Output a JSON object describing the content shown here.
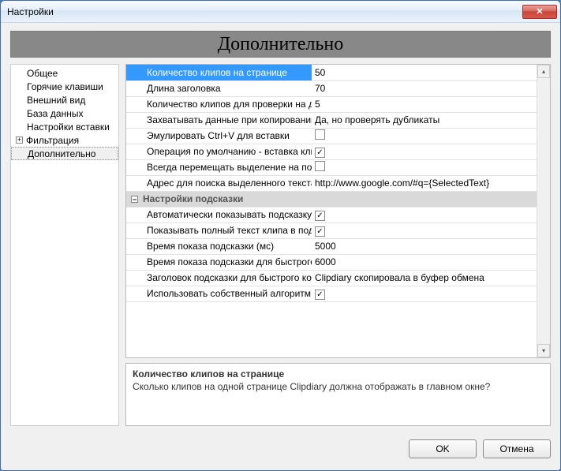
{
  "window": {
    "title": "Настройки",
    "close_label": "✕"
  },
  "header": "Дополнительно",
  "nav": {
    "items": [
      {
        "label": "Общее",
        "expander": "dots"
      },
      {
        "label": "Горячие клавиши",
        "expander": "dots"
      },
      {
        "label": "Внешний вид",
        "expander": "dots"
      },
      {
        "label": "База данных",
        "expander": "dots"
      },
      {
        "label": "Настройки вставки",
        "expander": "dots"
      },
      {
        "label": "Фильтрация",
        "expander": "plus"
      },
      {
        "label": "Дополнительно",
        "expander": "dots",
        "selected": true
      }
    ]
  },
  "grid": {
    "rows": [
      {
        "type": "row",
        "label": "Количество клипов на странице",
        "value": "50",
        "selected": true
      },
      {
        "type": "row",
        "label": "Длина заголовка",
        "value": "70"
      },
      {
        "type": "row",
        "label": "Количество клипов для проверки на дуб",
        "value": "5"
      },
      {
        "type": "row",
        "label": "Захватывать данные при копировании к",
        "value": "Да, но проверять дубликаты"
      },
      {
        "type": "row",
        "label": "Эмулировать Ctrl+V для вставки",
        "value_type": "check",
        "checked": false
      },
      {
        "type": "row",
        "label": "Операция по умолчанию - вставка клип",
        "value_type": "check",
        "checked": true
      },
      {
        "type": "row",
        "label": "Всегда перемещать выделение на посл",
        "value_type": "check",
        "checked": false
      },
      {
        "type": "row",
        "label": "Адрес для поиска выделенного текста в",
        "value": "http://www.google.com/#q={SelectedText}"
      },
      {
        "type": "section",
        "label": "Настройки подсказки"
      },
      {
        "type": "row",
        "label": "Автоматически показывать подсказку п",
        "value_type": "check",
        "checked": true
      },
      {
        "type": "row",
        "label": "Показывать полный текст клипа в подск",
        "value_type": "check",
        "checked": true
      },
      {
        "type": "row",
        "label": "Время показа подсказки (мс)",
        "value": "5000"
      },
      {
        "type": "row",
        "label": "Время показа подсказки для быстрого к",
        "value": "6000"
      },
      {
        "type": "row",
        "label": "Заголовок подсказки для быстрого копи",
        "value": "   Clipdiary скопировала в буфер обмена"
      },
      {
        "type": "row",
        "label": "Использовать собственный алгоритм д",
        "value_type": "check",
        "checked": true
      }
    ]
  },
  "help": {
    "title": "Количество клипов на странице",
    "text": "Сколько клипов на одной странице Clipdiary должна отображать в главном окне?"
  },
  "footer": {
    "ok": "OK",
    "cancel": "Отмена"
  },
  "scroll": {
    "up": "▴",
    "down": "▾"
  }
}
